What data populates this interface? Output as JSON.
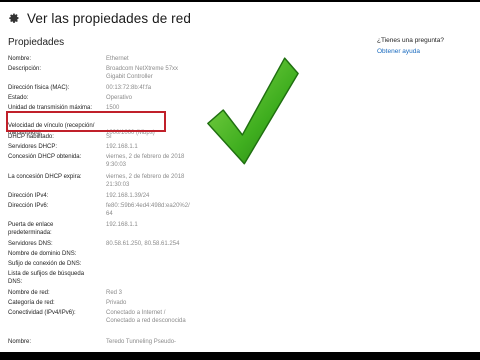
{
  "header": {
    "title": "Ver las propiedades de red",
    "icon": "gear-icon"
  },
  "section": {
    "title": "Propiedades"
  },
  "help": {
    "question": "¿Tienes una pregunta?",
    "link": "Obtener ayuda"
  },
  "properties": [
    {
      "label": "Nombre:",
      "value": "Ethernet"
    },
    {
      "label": "Descripción:",
      "value": "Broadcom NetXtreme 57xx\nGigabit Controller"
    },
    {
      "label": "Dirección física (MAC):",
      "value": "00:13:72:8b:4f:fa"
    },
    {
      "label": "Estado:",
      "value": "Operativo"
    },
    {
      "label": "Unidad de transmisión máxima:",
      "value": "1500"
    },
    {
      "label": "Velocidad de vínculo (recepción/\ntransmisión):",
      "value": "1000/1000 (Mbps)"
    },
    {
      "label": "DHCP habilitado:",
      "value": "Sí"
    },
    {
      "label": "Servidores DHCP:",
      "value": "192.168.1.1"
    },
    {
      "label": "Concesión DHCP obtenida:",
      "value": "viernes, 2 de febrero de 2018\n9:30:03"
    },
    {
      "label": "La concesión DHCP expira:",
      "value": "viernes, 2 de febrero de 2018\n21:30:03"
    },
    {
      "label": "Dirección IPv4:",
      "value": "192.168.1.39/24"
    },
    {
      "label": "Dirección IPv6:",
      "value": "fe80::59b6:4ed4:498d:ea20%2/\n64"
    },
    {
      "label": "Puerta de enlace\npredeterminada:",
      "value": "192.168.1.1"
    },
    {
      "label": "Servidores DNS:",
      "value": "80.58.61.250, 80.58.61.254"
    },
    {
      "label": "Nombre de dominio DNS:",
      "value": ""
    },
    {
      "label": "Sufijo de conexión de DNS:",
      "value": ""
    },
    {
      "label": "Lista de sufijos de búsqueda\nDNS:",
      "value": ""
    },
    {
      "label": "Nombre de red:",
      "value": "Red 3"
    },
    {
      "label": "Categoría de red:",
      "value": "Privado"
    },
    {
      "label": "Conectividad (IPv4/IPv6):",
      "value": "Conectado a Internet /\nConectado a red desconocida"
    },
    {
      "label": "Nombre:",
      "value": "Teredo Tunneling Pseudo-"
    }
  ],
  "overlay": {
    "icon": "green-checkmark-icon",
    "highlight_color": "#c0202a",
    "check_color": "#3fae1f"
  }
}
